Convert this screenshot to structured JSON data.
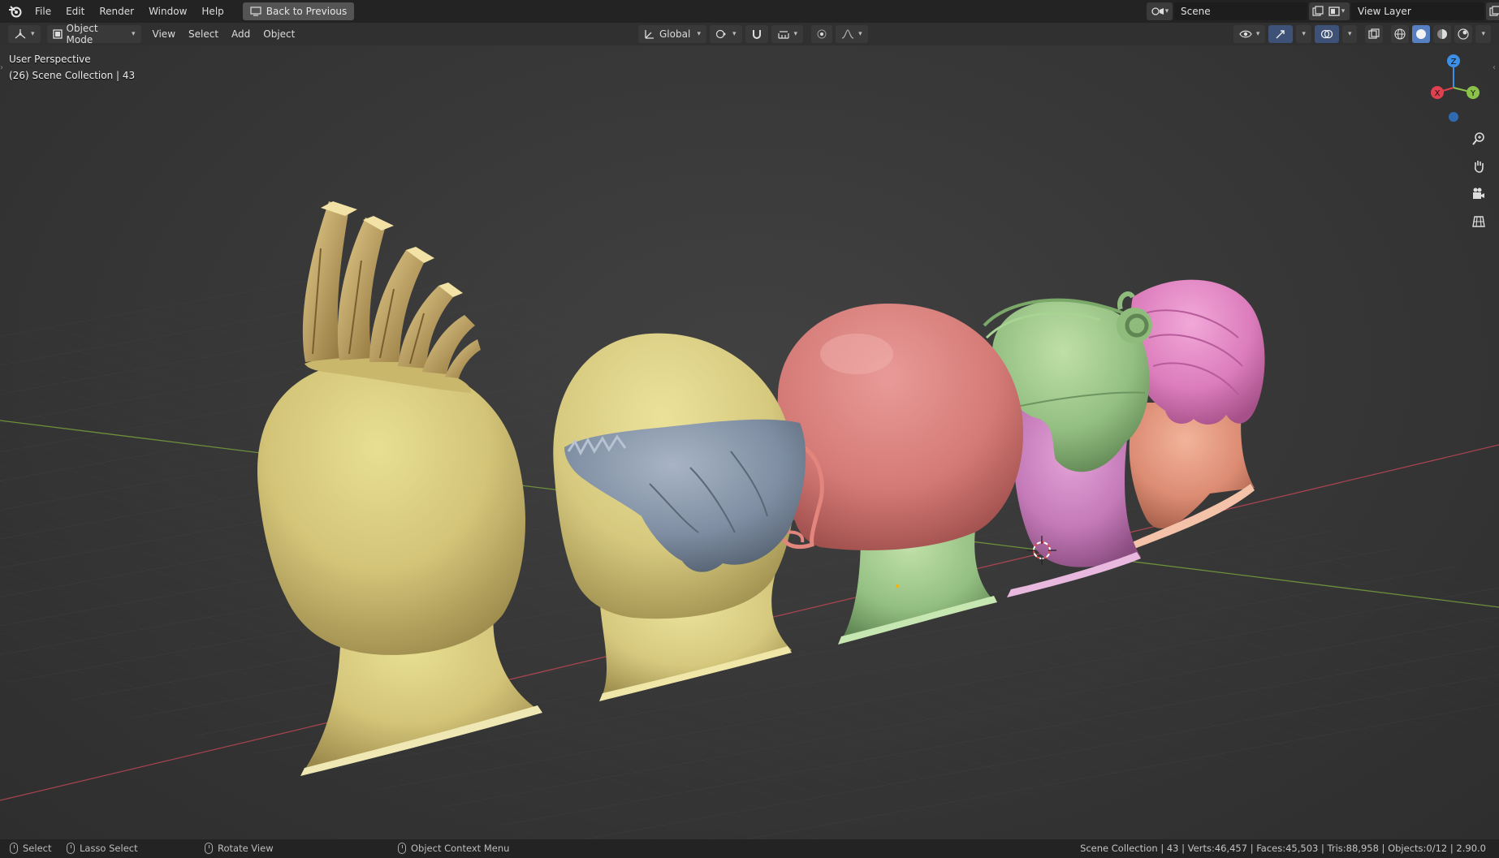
{
  "menu": {
    "items": [
      "File",
      "Edit",
      "Render",
      "Window",
      "Help"
    ],
    "back_button": "Back to Previous"
  },
  "scene_selector": {
    "value": "Scene"
  },
  "view_layer_selector": {
    "value": "View Layer"
  },
  "header": {
    "mode": "Object Mode",
    "menus": [
      "View",
      "Select",
      "Add",
      "Object"
    ],
    "transform_orientation": "Global"
  },
  "viewport": {
    "view_name": "User Perspective",
    "collection_info": "(26) Scene Collection | 43",
    "gizmo_axes": {
      "x": "X",
      "y": "Y",
      "z": "Z"
    }
  },
  "statusbar": {
    "select": "Select",
    "lasso": "Lasso Select",
    "rotate": "Rotate View",
    "context_menu": "Object Context Menu",
    "stats": "Scene Collection | 43 | Verts:46,457 | Faces:45,503 | Tris:88,958 | Objects:0/12 | 2.90.0"
  },
  "colors": {
    "topbar": "#232323",
    "viewport": "#3a3a3a",
    "active_shading": "#5680c2",
    "axis_x": "#e0404f",
    "axis_y": "#8bc34a",
    "axis_z": "#3d8ee5"
  }
}
